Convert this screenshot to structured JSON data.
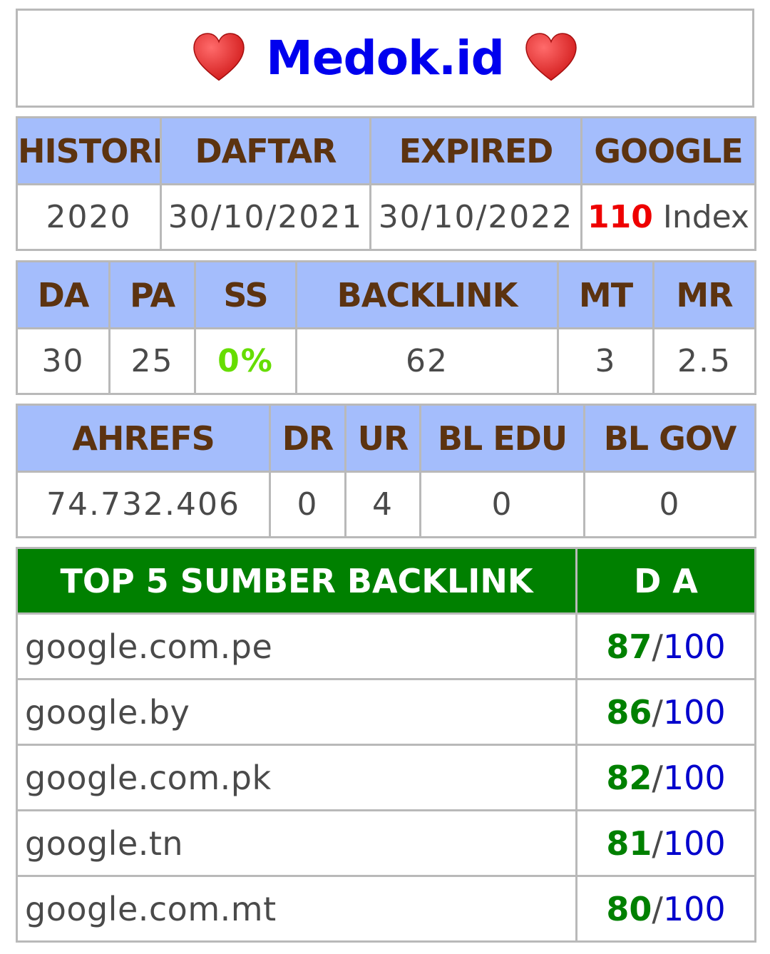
{
  "title": "Medok.id",
  "histori_table": {
    "headers": [
      "HISTORI",
      "DAFTAR",
      "EXPIRED",
      "GOOGLE"
    ],
    "histori": "2020",
    "daftar": "30/10/2021",
    "expired": "30/10/2022",
    "google_count": "110",
    "google_suffix": " Index"
  },
  "metrics_table": {
    "headers": [
      "DA",
      "PA",
      "SS",
      "BACKLINK",
      "MT",
      "MR"
    ],
    "values": [
      "30",
      "25",
      "0%",
      "62",
      "3",
      "2.5"
    ]
  },
  "ahrefs_table": {
    "headers": [
      "AHREFS",
      "DR",
      "UR",
      "BL EDU",
      "BL GOV"
    ],
    "values": [
      "74.732.406",
      "0",
      "4",
      "0",
      "0"
    ]
  },
  "backlinks_table": {
    "header_source": "TOP 5 SUMBER BACKLINK",
    "header_da": "D A",
    "max": "100",
    "slash": "/",
    "rows": [
      {
        "source": "google.com.pe",
        "da": "87"
      },
      {
        "source": "google.by",
        "da": "86"
      },
      {
        "source": "google.com.pk",
        "da": "82"
      },
      {
        "source": "google.tn",
        "da": "81"
      },
      {
        "source": "google.com.mt",
        "da": "80"
      }
    ]
  },
  "colors": {
    "header_bg": "#a4bdfc",
    "header_text": "#5c3310",
    "green_header": "#008000",
    "title_blue": "#0000ee",
    "google_red": "#ee0000",
    "ss_green": "#66dd00"
  },
  "icons": [
    "heart-icon",
    "heart-icon"
  ]
}
